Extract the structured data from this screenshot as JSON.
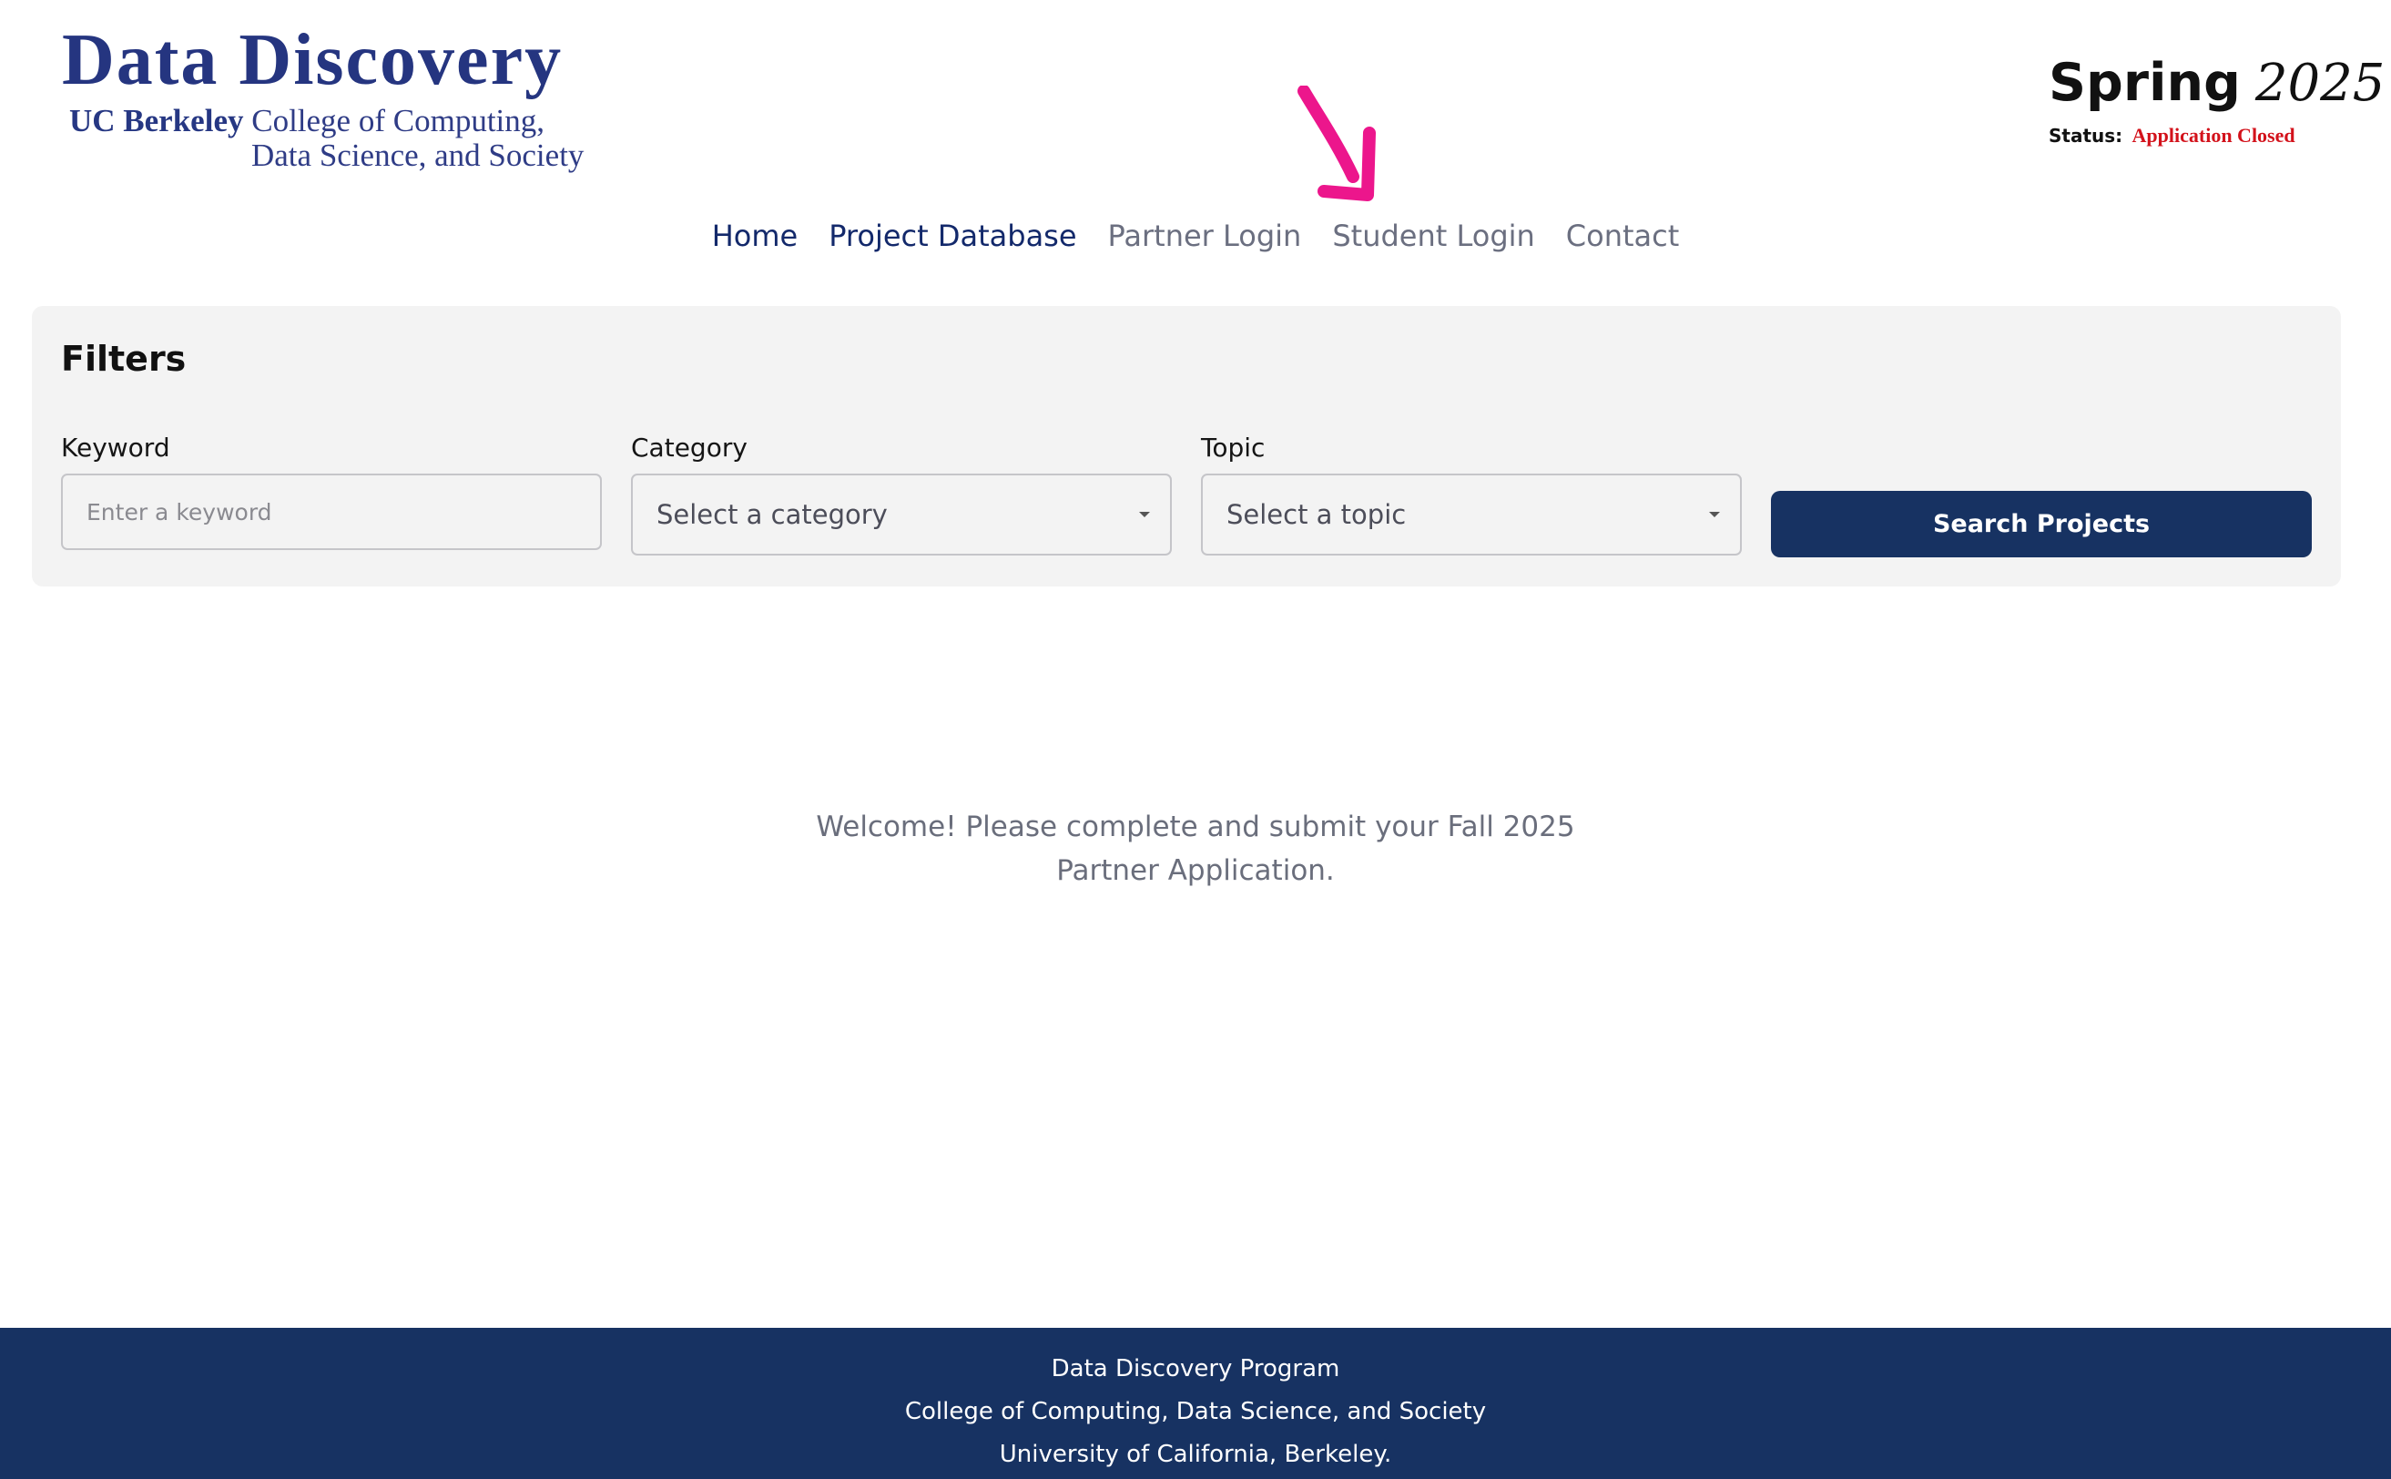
{
  "logo": {
    "title": "Data Discovery",
    "line1_bold": "UC Berkeley",
    "line1_rest": " College of Computing,",
    "line2": "Data Science, and Society"
  },
  "term": {
    "season": "Spring",
    "year": "2025",
    "status_label": "Status:",
    "status_value": "Application Closed",
    "status_color": "#d3121b"
  },
  "annotation": {
    "icon": "arrow-down-right-icon",
    "color": "#ec168c"
  },
  "nav": {
    "items": [
      {
        "label": "Home"
      },
      {
        "label": "Project Database"
      },
      {
        "label": "Partner Login"
      },
      {
        "label": "Student Login"
      },
      {
        "label": "Contact"
      }
    ]
  },
  "filters": {
    "title": "Filters",
    "keyword": {
      "label": "Keyword",
      "placeholder": "Enter a keyword",
      "value": ""
    },
    "category": {
      "label": "Category",
      "selected": "Select a category"
    },
    "topic": {
      "label": "Topic",
      "selected": "Select a topic"
    },
    "search_button": "Search Projects"
  },
  "welcome": {
    "line1": "Welcome! Please complete and submit your Fall 2025",
    "line2": "Partner Application."
  },
  "footer": {
    "line1": "Data Discovery Program",
    "line2": "College of Computing, Data Science, and Society",
    "line3": "University of California, Berkeley."
  },
  "colors": {
    "navy": "#173262",
    "nav_active": "#13296b",
    "nav_inactive": "#6b6f80",
    "logo_blue": "#253580",
    "panel_bg": "#f3f3f3"
  }
}
